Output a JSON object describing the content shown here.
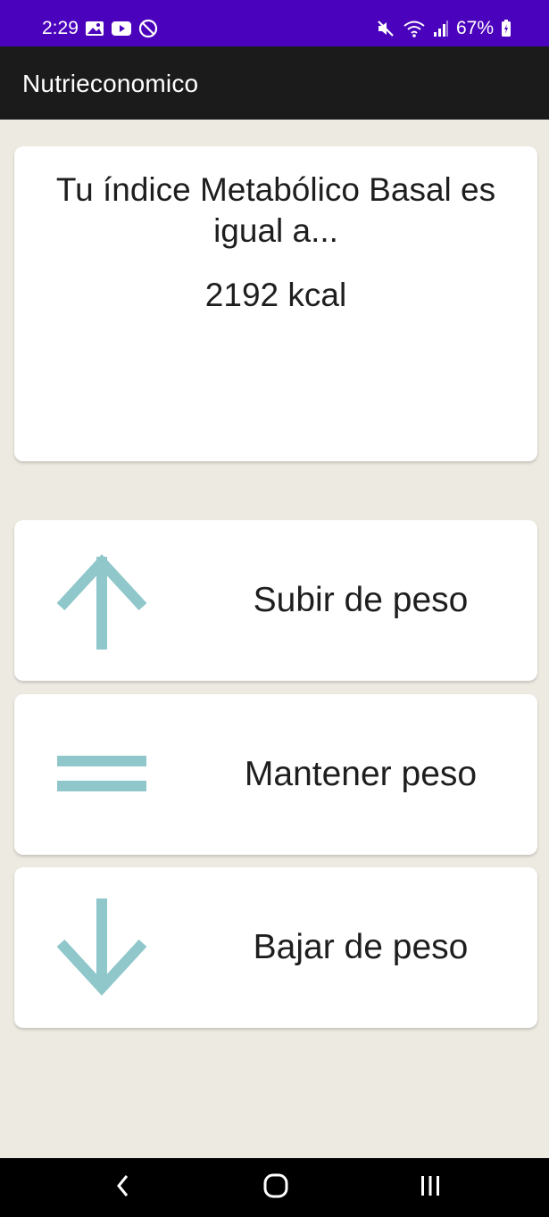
{
  "status_bar": {
    "time": "2:29",
    "battery": "67%",
    "left_icons": [
      "gallery-icon",
      "youtube-icon",
      "do-not-disturb-icon"
    ],
    "right_icons": [
      "mute-icon",
      "wifi-icon",
      "signal-icon",
      "battery-icon"
    ]
  },
  "app_bar": {
    "title": "Nutrieconomico"
  },
  "bmr_card": {
    "heading": "Tu índice Metabólico Basal es igual a...",
    "value": "2192 kcal"
  },
  "options": [
    {
      "label": "Subir de peso",
      "icon": "arrow-up-icon"
    },
    {
      "label": "Mantener peso",
      "icon": "equals-icon"
    },
    {
      "label": "Bajar de peso",
      "icon": "arrow-down-icon"
    }
  ],
  "nav_bar": {
    "buttons": [
      "back-icon",
      "home-icon",
      "recents-icon"
    ]
  },
  "colors": {
    "status_bar": "#4B02BC",
    "app_bar": "#1B1B1B",
    "background": "#ECEAE1",
    "icon_accent": "#8FC7CB"
  }
}
